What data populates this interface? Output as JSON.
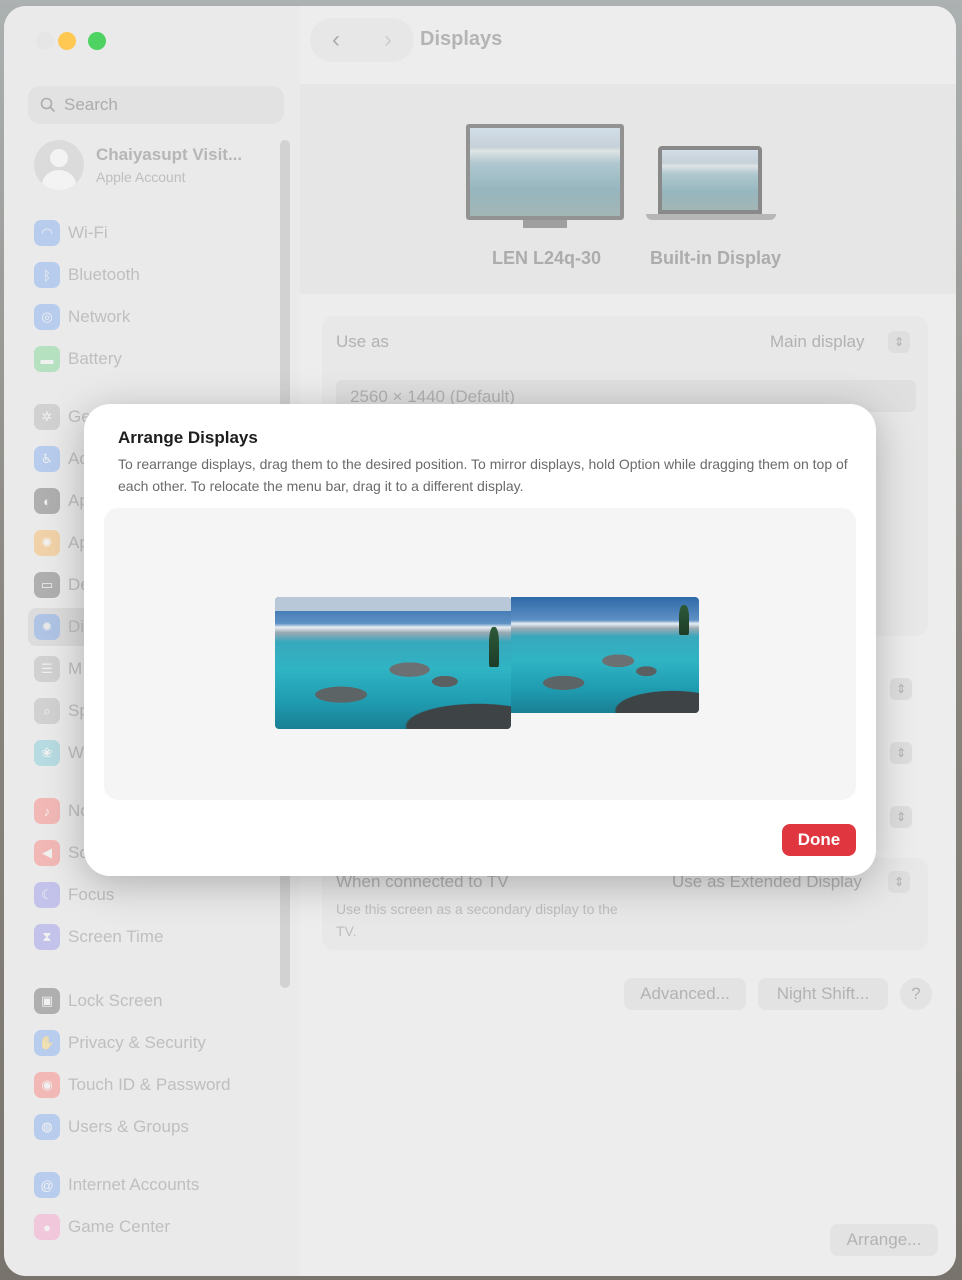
{
  "window": {
    "title": "Displays"
  },
  "sidebar": {
    "search_placeholder": "Search",
    "account": {
      "name": "Chaiyasupt Visit...",
      "subtitle": "Apple Account"
    },
    "items": [
      {
        "label": "Wi-Fi",
        "icon": "wifi-icon",
        "color": "#3b82f6"
      },
      {
        "label": "Bluetooth",
        "icon": "bluetooth-icon",
        "color": "#3b82f6"
      },
      {
        "label": "Network",
        "icon": "globe-icon",
        "color": "#3b82f6"
      },
      {
        "label": "Battery",
        "icon": "battery-icon",
        "color": "#34c759"
      },
      {
        "label": "Ge",
        "icon": "gear-icon",
        "color": "#8e8e93"
      },
      {
        "label": "Ac",
        "icon": "accessibility-icon",
        "color": "#3b82f6"
      },
      {
        "label": "Ap",
        "icon": "appearance-icon",
        "color": "#1c1c1e"
      },
      {
        "label": "Ap",
        "icon": "apple-intelligence-icon",
        "color": "#ff9500"
      },
      {
        "label": "De",
        "icon": "desktop-dock-icon",
        "color": "#1c1c1e"
      },
      {
        "label": "Di",
        "icon": "sun-icon",
        "color": "#3b82f6"
      },
      {
        "label": "M",
        "icon": "menu-bar-icon",
        "color": "#8e8e93"
      },
      {
        "label": "Sp",
        "icon": "spotlight-icon",
        "color": "#8e8e93"
      },
      {
        "label": "W",
        "icon": "wallpaper-icon",
        "color": "#30b0c7"
      },
      {
        "label": "No",
        "icon": "bell-icon",
        "color": "#ff3b30"
      },
      {
        "label": "So",
        "icon": "speaker-icon",
        "color": "#ff3b30"
      },
      {
        "label": "Focus",
        "icon": "moon-icon",
        "color": "#5e5ce6"
      },
      {
        "label": "Screen Time",
        "icon": "hourglass-icon",
        "color": "#5e5ce6"
      },
      {
        "label": "Lock Screen",
        "icon": "lock-icon",
        "color": "#1c1c1e"
      },
      {
        "label": "Privacy & Security",
        "icon": "hand-icon",
        "color": "#3b82f6"
      },
      {
        "label": "Touch ID & Password",
        "icon": "fingerprint-icon",
        "color": "#ff3b30"
      },
      {
        "label": "Users & Groups",
        "icon": "users-icon",
        "color": "#3b82f6"
      },
      {
        "label": "Internet Accounts",
        "icon": "at-icon",
        "color": "#3b82f6"
      },
      {
        "label": "Game Center",
        "icon": "game-center-icon",
        "color": "#ff6fb5"
      }
    ]
  },
  "displays": {
    "external": "LEN L24q-30",
    "builtin": "Built-in Display"
  },
  "settings": {
    "use_as_label": "Use as",
    "use_as_value": "Main display",
    "resolution": "2560 × 1440 (Default)",
    "tv_label": "When connected to TV",
    "tv_value": "Use as Extended Display",
    "tv_desc": "Use this screen as a secondary display to the TV.",
    "advanced": "Advanced...",
    "night_shift": "Night Shift...",
    "help": "?",
    "arrange": "Arrange..."
  },
  "dialog": {
    "title": "Arrange Displays",
    "description": "To rearrange displays, drag them to the desired position. To mirror displays, hold Option while dragging them on top of each other. To relocate the menu bar, drag it to a different display.",
    "done": "Done",
    "done_color": "#e0363f"
  }
}
